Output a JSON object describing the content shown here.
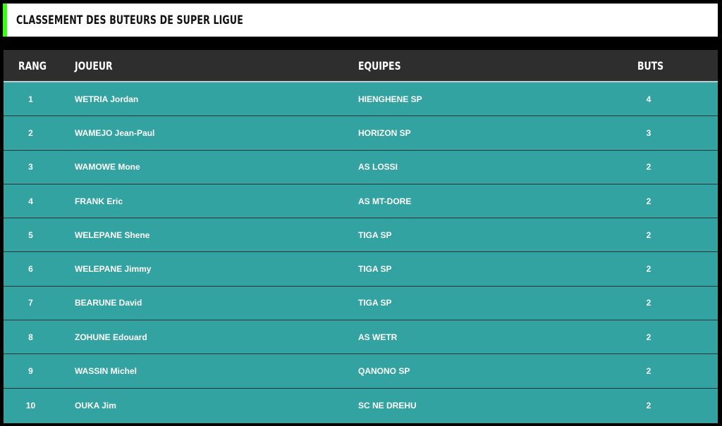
{
  "header": {
    "title": "CLASSEMENT DES BUTEURS DE SUPER LIGUE",
    "accent_color": "#39ff14"
  },
  "table": {
    "columns": {
      "rank": "RANG",
      "player": "JOUEUR",
      "team": "EQUIPES",
      "goals": "BUTS"
    },
    "row_color": "#32a3a0",
    "header_color": "#2e2e2e",
    "rows": [
      {
        "rank": "1",
        "player": "WETRIA Jordan",
        "team": "HIENGHENE SP",
        "goals": "4"
      },
      {
        "rank": "2",
        "player": "WAMEJO Jean-Paul",
        "team": "HORIZON SP",
        "goals": "3"
      },
      {
        "rank": "3",
        "player": "WAMOWE Mone",
        "team": "AS LOSSI",
        "goals": "2"
      },
      {
        "rank": "4",
        "player": "FRANK Eric",
        "team": "AS MT-DORE",
        "goals": "2"
      },
      {
        "rank": "5",
        "player": "WELEPANE Shene",
        "team": "TIGA SP",
        "goals": "2"
      },
      {
        "rank": "6",
        "player": "WELEPANE Jimmy",
        "team": "TIGA SP",
        "goals": "2"
      },
      {
        "rank": "7",
        "player": "BEARUNE David",
        "team": "TIGA SP",
        "goals": "2"
      },
      {
        "rank": "8",
        "player": "ZOHUNE Edouard",
        "team": "AS WETR",
        "goals": "2"
      },
      {
        "rank": "9",
        "player": "WASSIN Michel",
        "team": "QANONO SP",
        "goals": "2"
      },
      {
        "rank": "10",
        "player": "OUKA Jim",
        "team": "SC NE DREHU",
        "goals": "2"
      }
    ]
  }
}
